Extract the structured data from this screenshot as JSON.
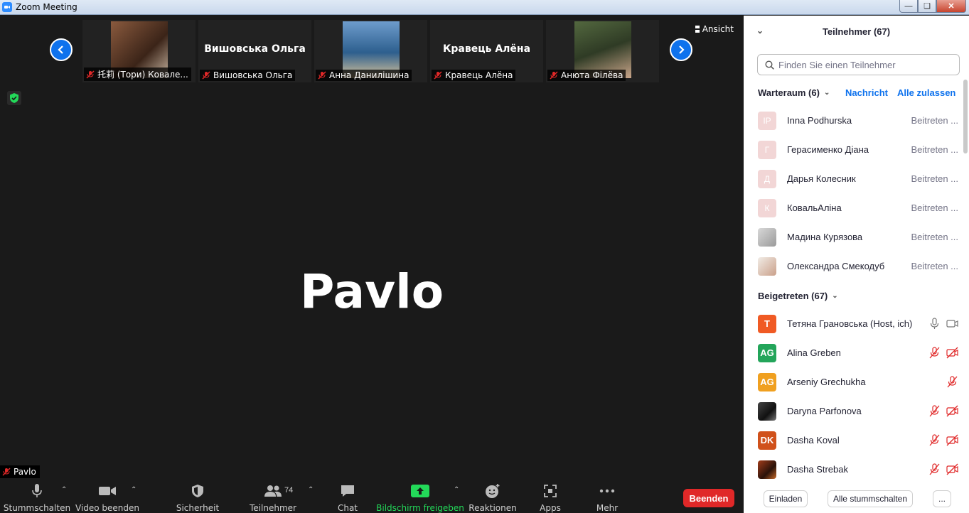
{
  "window": {
    "title": "Zoom Meeting"
  },
  "video_strip": {
    "tiles": [
      {
        "label": "托莉 (Тори) Ковале...",
        "type": "photo",
        "photo_color": "#6b3a2a"
      },
      {
        "label": "Вишовська Ольга",
        "type": "name",
        "big_name": "Вишовська Ольга"
      },
      {
        "label": "Анна Данилішина",
        "type": "photo",
        "photo_color": "#3d6a96"
      },
      {
        "label": "Кравець Алёна",
        "type": "name",
        "big_name": "Кравець Алёна"
      },
      {
        "label": "Анюта Філёва",
        "type": "photo",
        "photo_color": "#4b5a3a"
      }
    ],
    "view_label": "Ansicht"
  },
  "active_speaker": {
    "name": "Pavlo"
  },
  "self_view": {
    "name": "Pavlo"
  },
  "toolbar": {
    "mute": "Stummschalten",
    "video": "Video beenden",
    "security": "Sicherheit",
    "participants": "Teilnehmer",
    "participants_count": "74",
    "chat": "Chat",
    "share": "Bildschirm freigeben",
    "reactions": "Reaktionen",
    "apps": "Apps",
    "more": "Mehr",
    "end": "Beenden"
  },
  "panel": {
    "title": "Teilnehmer (67)",
    "search_placeholder": "Finden Sie einen Teilnehmer",
    "waiting_room": {
      "header": "Warteraum (6)",
      "message_link": "Nachricht",
      "admit_all_link": "Alle zulassen",
      "items": [
        {
          "initials": "IP",
          "name": "Inna Podhurska",
          "action": "Beitreten ..."
        },
        {
          "initials": "Г",
          "name": "Герасименко Діана",
          "action": "Beitreten ..."
        },
        {
          "initials": "Д",
          "name": "Дарья Колесник",
          "action": "Beitreten ..."
        },
        {
          "initials": "К",
          "name": "КовальАліна",
          "action": "Beitreten ..."
        },
        {
          "initials": "",
          "name": "Мадина Курязова",
          "action": "Beitreten ..."
        },
        {
          "initials": "",
          "name": "Олександра Смекодуб",
          "action": "Beitreten ..."
        }
      ]
    },
    "joined": {
      "header": "Beigetreten (67)",
      "items": [
        {
          "initials": "T",
          "color": "#f05a24",
          "name": "Тетяна Грановська (Host, ich)",
          "muted": false,
          "video_off": false
        },
        {
          "initials": "AG",
          "color": "#23a55a",
          "name": "Alina Greben",
          "muted": true,
          "video_off": true
        },
        {
          "initials": "AG",
          "color": "#f0a020",
          "name": "Arseniy Grechukha",
          "muted": true,
          "video_off": false,
          "no_video_icon": true
        },
        {
          "initials": "",
          "color": "#333333",
          "name": "Daryna Parfonova",
          "muted": true,
          "video_off": true
        },
        {
          "initials": "DK",
          "color": "#d0511b",
          "name": "Dasha Koval",
          "muted": true,
          "video_off": true
        },
        {
          "initials": "",
          "color": "#5a2a1a",
          "name": "Dasha Strebak",
          "muted": true,
          "video_off": true
        }
      ]
    },
    "footer": {
      "invite": "Einladen",
      "mute_all": "Alle stummschalten",
      "more": "..."
    }
  }
}
